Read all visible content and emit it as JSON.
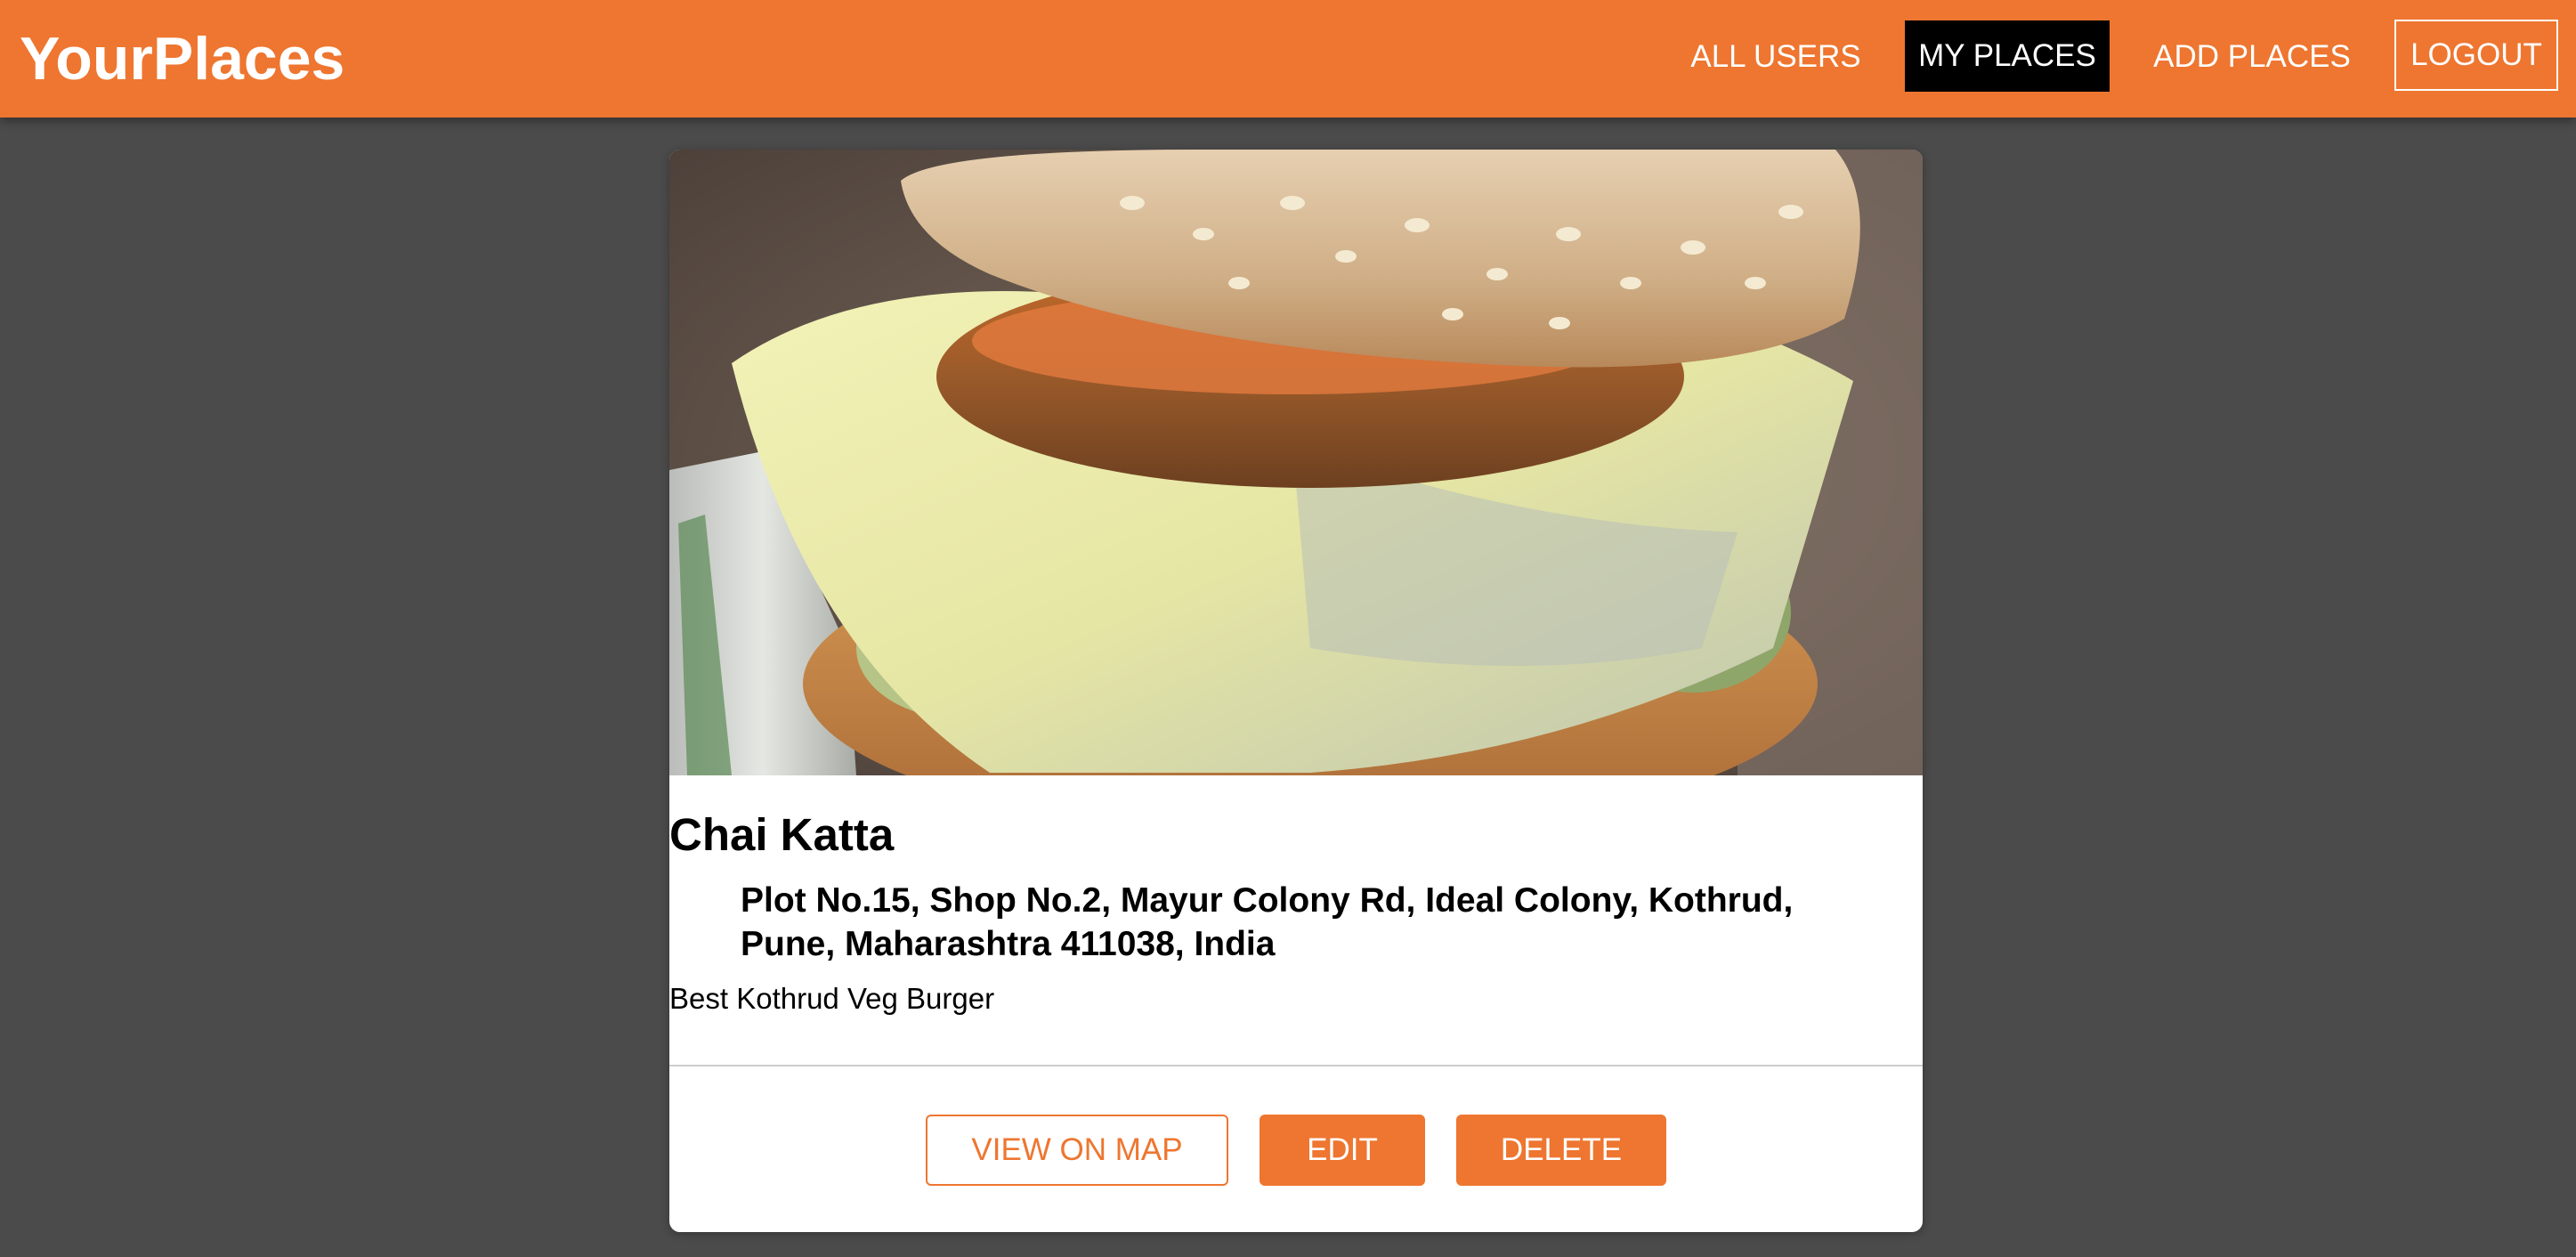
{
  "header": {
    "logo": "YourPlaces",
    "nav": {
      "all_users": "ALL USERS",
      "my_places": "MY PLACES",
      "add_places": "ADD PLACES",
      "logout": "LOGOUT"
    },
    "active_nav": "my_places"
  },
  "place": {
    "image_icon": "burger-photo",
    "title": "Chai Katta",
    "address": "Plot No.15, Shop No.2, Mayur Colony Rd, Ideal Colony, Kothrud, Pune, Maharashtra 411038, India",
    "description": "Best Kothrud Veg Burger"
  },
  "actions": {
    "view_on_map": "VIEW ON MAP",
    "edit": "EDIT",
    "delete": "DELETE"
  },
  "colors": {
    "brand": "#ee7630",
    "background": "#4b4b4b",
    "active_nav_bg": "#000000",
    "card_bg": "#ffffff"
  }
}
